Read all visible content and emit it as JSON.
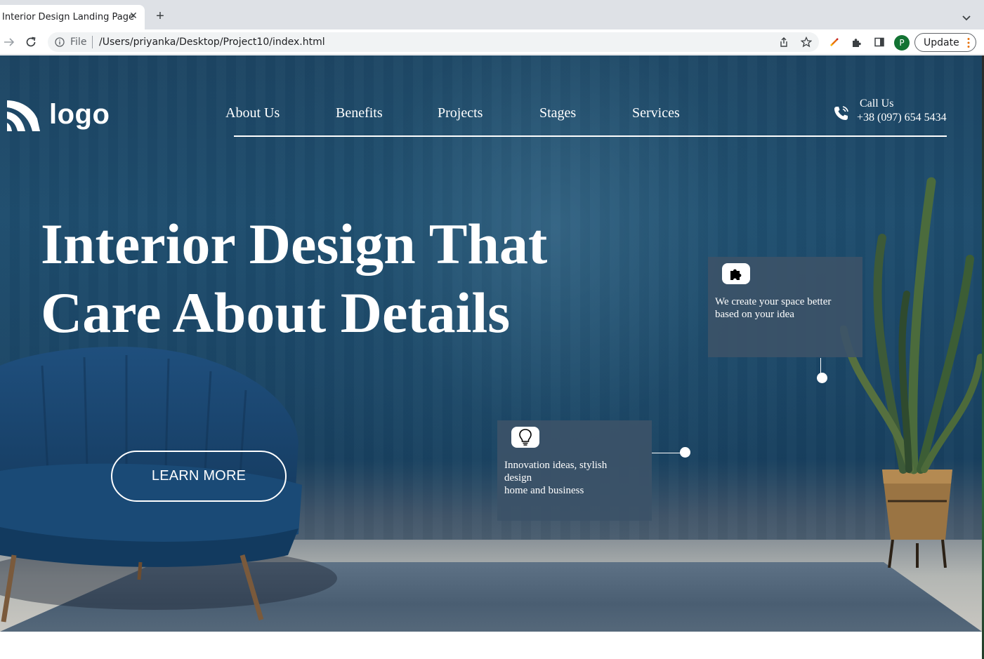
{
  "browser": {
    "tab_title": "Interior Design Landing Page",
    "url_scheme": "File",
    "url": "/Users/priyanka/Desktop/Project10/index.html",
    "profile_initial": "P",
    "update_label": "Update",
    "accent_color": "#e8710a"
  },
  "header": {
    "logo_text": "logo",
    "nav": [
      {
        "label": "About Us"
      },
      {
        "label": "Benefits"
      },
      {
        "label": "Projects"
      },
      {
        "label": "Stages"
      },
      {
        "label": "Services"
      }
    ],
    "call_label": "Call Us",
    "call_phone": "+38 (097) 654 5434"
  },
  "hero": {
    "headline_line1": "Interior Design That",
    "headline_line2": "Care About Details",
    "cta_label": "LEARN MORE"
  },
  "cards": {
    "idea": {
      "icon": "puzzle-icon",
      "line1": "We create your space better",
      "line2": "based on your idea"
    },
    "innovation": {
      "icon": "lightbulb-icon",
      "line1": "Innovation ideas, stylish",
      "line2": "design",
      "line3": "home and business"
    }
  }
}
